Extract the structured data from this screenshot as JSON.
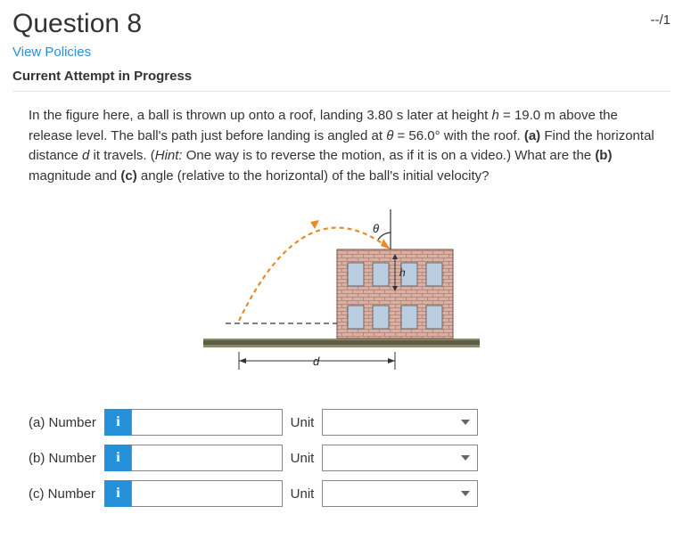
{
  "header": {
    "title": "Question 8",
    "score": "--/1",
    "policies": "View Policies",
    "attempt": "Current Attempt in Progress"
  },
  "problem": {
    "text_html": "In the figure here, a ball is thrown up onto a roof, landing 3.80 s later at height <i>h</i> = 19.0 m above the release level. The ball's path just before landing is angled at <i>θ</i> = 56.0° with the roof. <b>(a)</b> Find the horizontal distance <i>d</i> it travels. (<i>Hint:</i> One way is to reverse the motion, as if it is on a video.) What are the <b>(b)</b> magnitude and <b>(c)</b> angle (relative to the horizontal) of the ball's initial velocity?"
  },
  "figure": {
    "theta_label": "θ",
    "h_label": "h",
    "d_label": "d"
  },
  "answers": {
    "info_glyph": "i",
    "unit_label": "Unit",
    "parts": [
      {
        "label": "(a) Number",
        "value": "",
        "unit": ""
      },
      {
        "label": "(b) Number",
        "value": "",
        "unit": ""
      },
      {
        "label": "(c) Number",
        "value": "",
        "unit": ""
      }
    ]
  }
}
